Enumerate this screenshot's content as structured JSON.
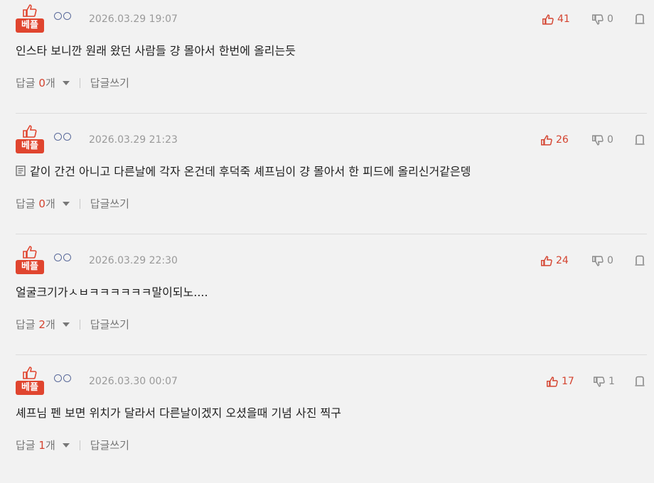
{
  "badge_label": "베플",
  "reply_label": "답글",
  "reply_unit": "개",
  "write_reply_label": "답글쓰기",
  "colors": {
    "accent": "#e0452f",
    "like": "#d4432f",
    "muted": "#8a8a8a",
    "background": "#f2f2f2"
  },
  "icons": [
    "thumbs-up-icon",
    "thumbs-down-icon",
    "report-icon",
    "document-icon",
    "chevron-down-icon"
  ],
  "comments": [
    {
      "timestamp": "2026.03.29 19:07",
      "likes": "41",
      "dislikes": "0",
      "text": "인스타 보니깐 원래 왔던 사람들 걍 몰아서 한번에 올리는듯",
      "replies": "0"
    },
    {
      "timestamp": "2026.03.29 21:23",
      "likes": "26",
      "dislikes": "0",
      "text": "같이 간건 아니고 다른날에 각자 온건데 후덕죽 셰프님이 걍 몰아서 한 피드에 올리신거같은뎅",
      "replies": "0"
    },
    {
      "timestamp": "2026.03.29 22:30",
      "likes": "24",
      "dislikes": "0",
      "text": "얼굴크기가ㅅㅂㅋㅋㅋㅋㅋㅋ말이되노....",
      "replies": "2"
    },
    {
      "timestamp": "2026.03.30 00:07",
      "likes": "17",
      "dislikes": "1",
      "text": "셰프님 펜 보면 위치가 달라서 다른날이겠지 오셨을때 기념 사진 찍구",
      "replies": "1"
    }
  ]
}
